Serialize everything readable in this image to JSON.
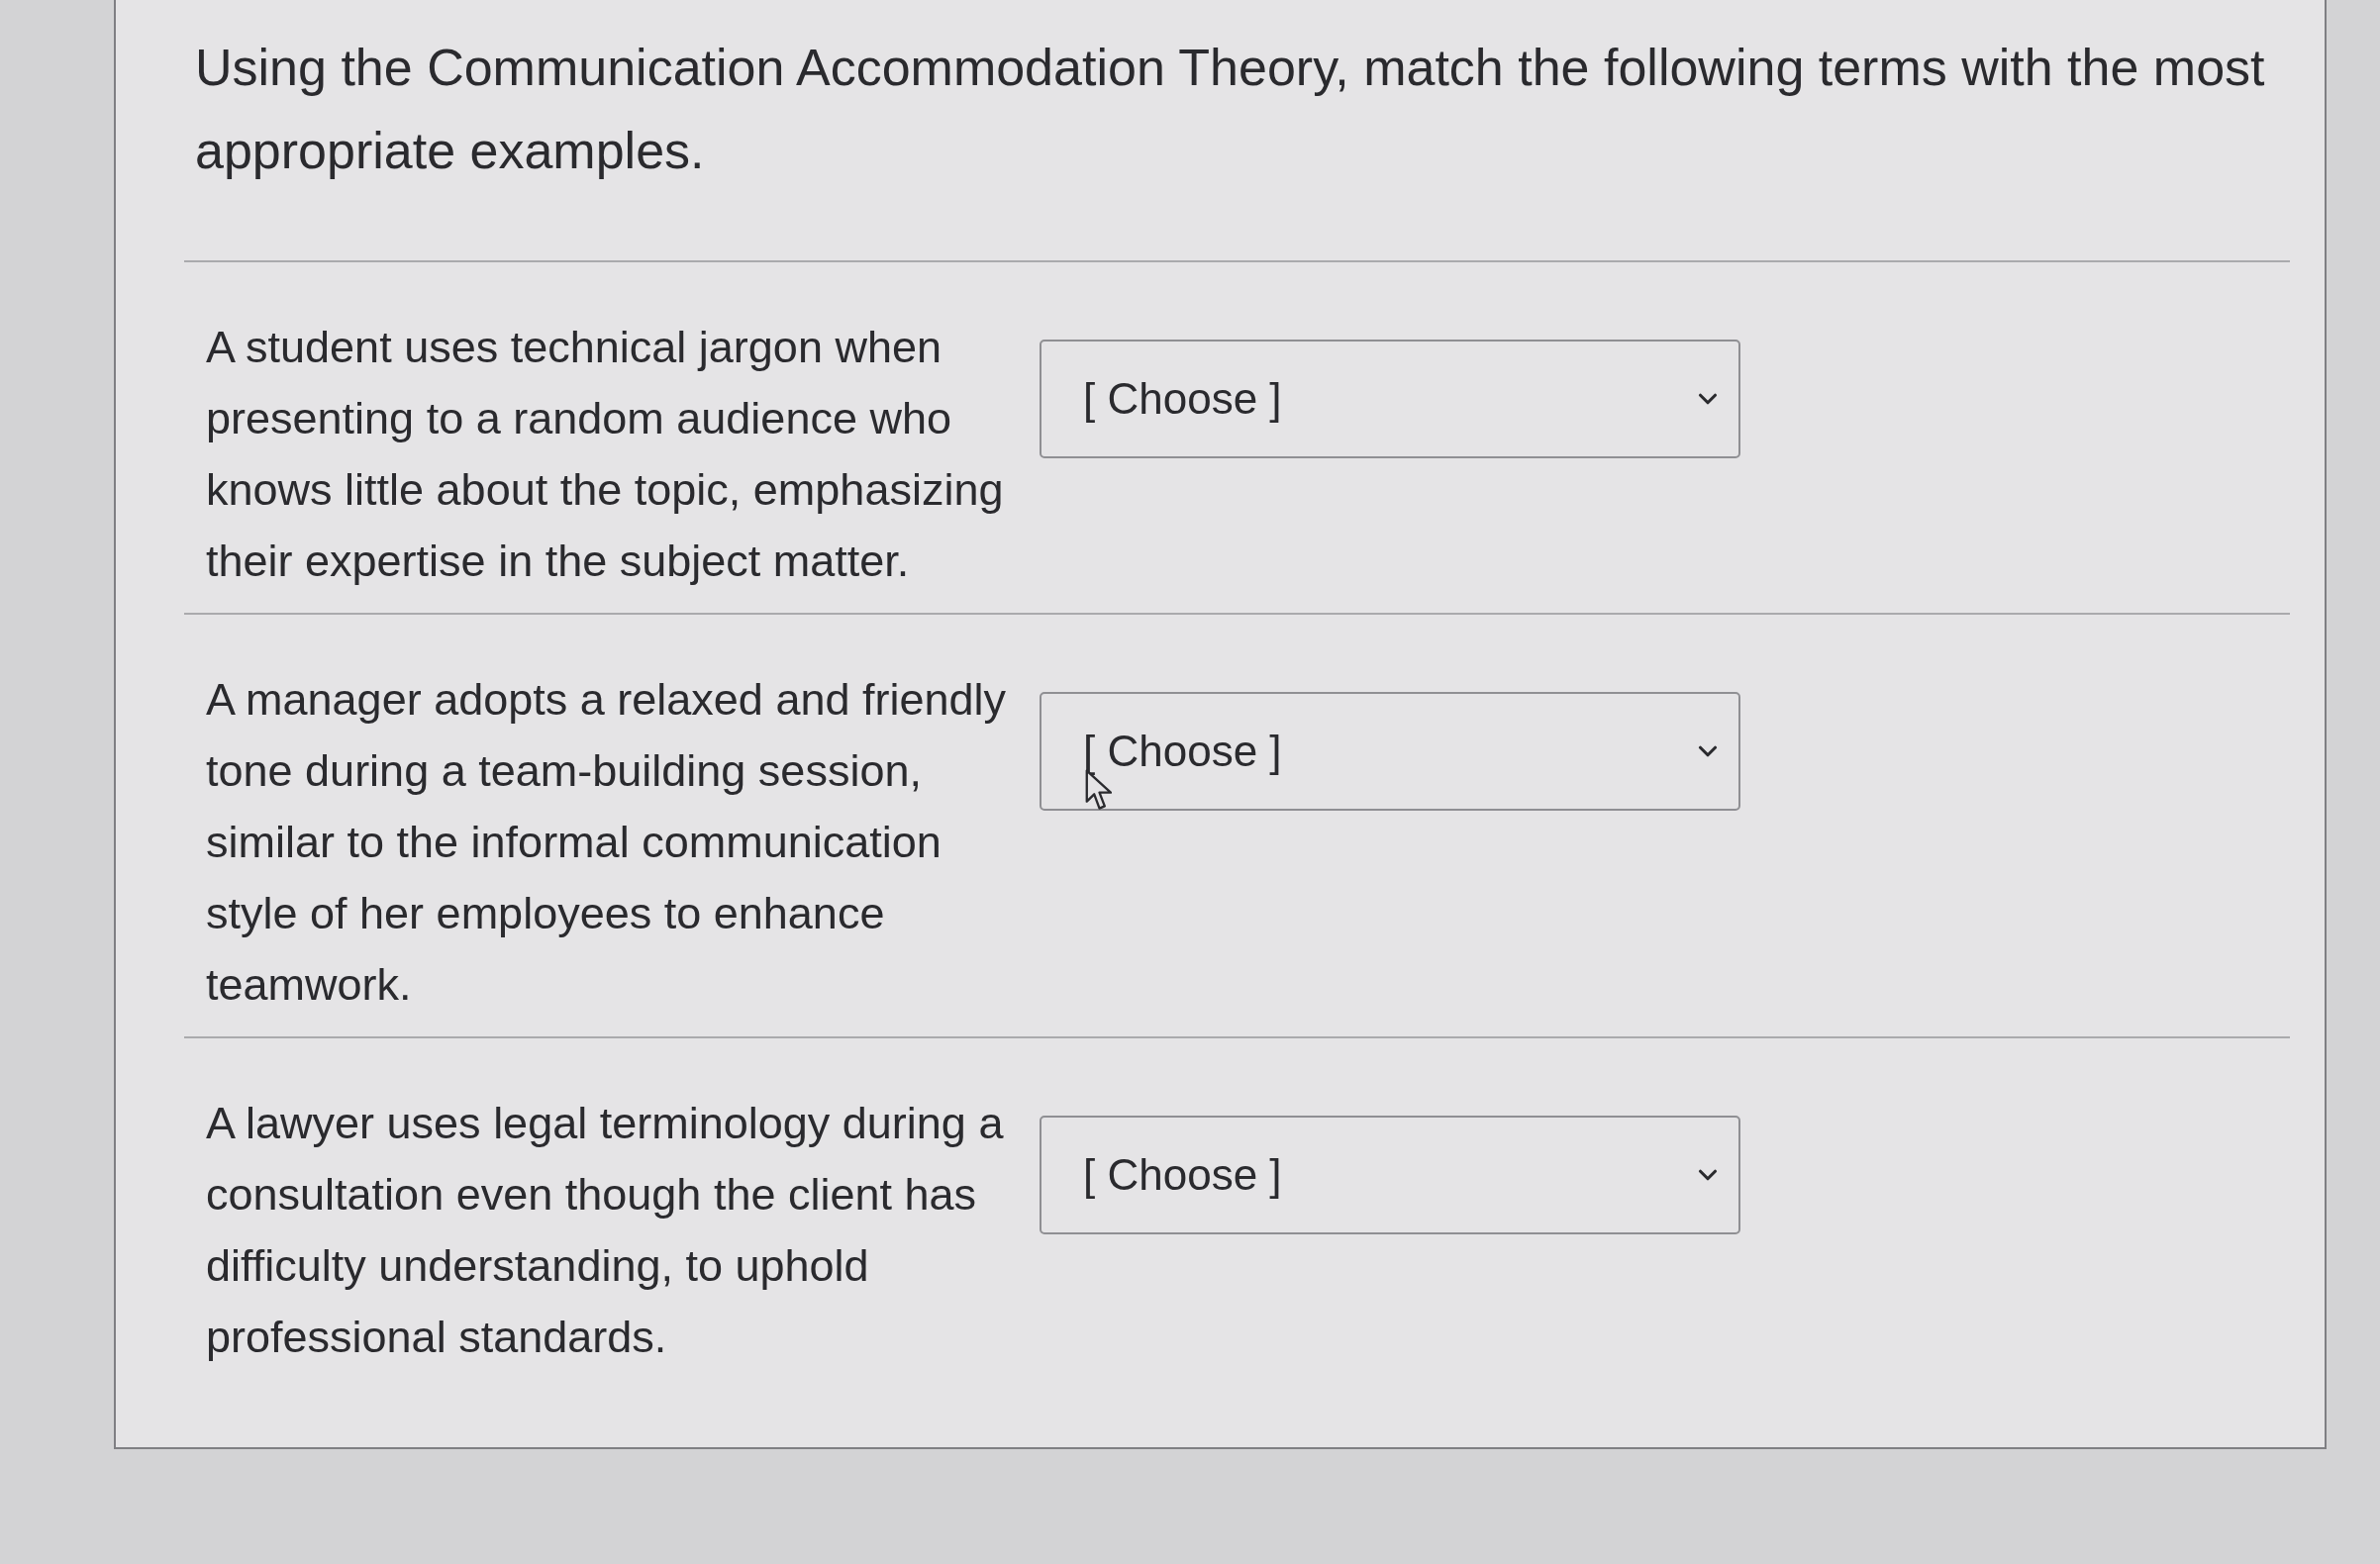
{
  "question": {
    "prompt": "Using the Communication Accommodation Theory, match the following terms with the most appropriate examples."
  },
  "matches": [
    {
      "example": "A student uses technical jargon when presenting to a random audience who knows little about the topic, emphasizing their expertise in the subject matter.",
      "dropdown": {
        "value": "[ Choose ]",
        "hovered": false
      }
    },
    {
      "example": "A manager adopts a relaxed and friendly tone during a team-building session, similar to the informal communication style of her employees to enhance teamwork.",
      "dropdown": {
        "value": "[ Choose ]",
        "hovered": true
      }
    },
    {
      "example": "A lawyer uses legal terminology during a consultation even though the client has difficulty understanding, to uphold professional standards.",
      "dropdown": {
        "value": "[ Choose ]",
        "hovered": false
      }
    }
  ]
}
